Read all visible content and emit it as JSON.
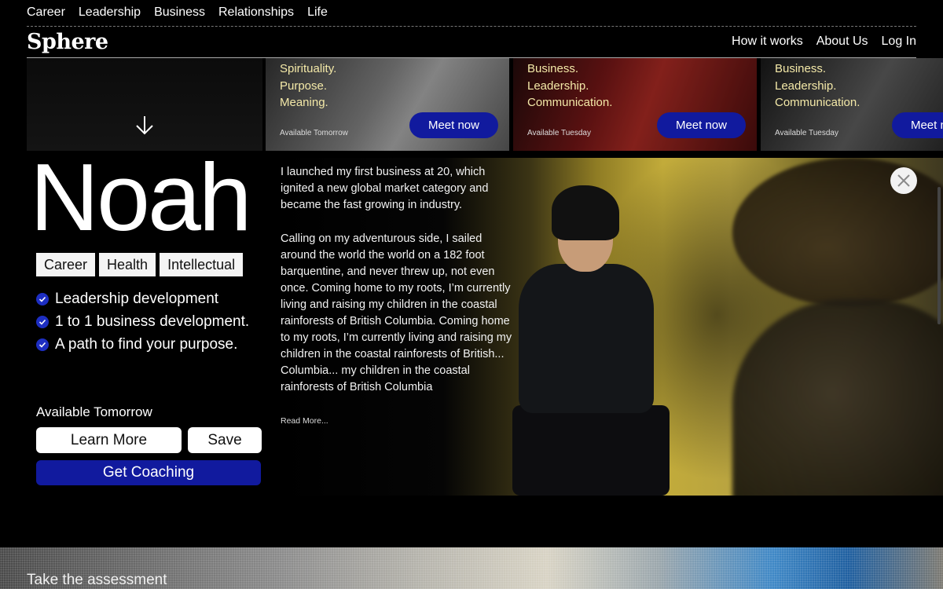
{
  "top_categories": [
    "Career",
    "Leadership",
    "Business",
    "Relationships",
    "Life"
  ],
  "logo": "Sphere",
  "main_nav": [
    "How it works",
    "About Us",
    "Log In"
  ],
  "carousel": [
    {
      "tags": [
        "Spirituality.",
        "Purpose.",
        "Meaning."
      ],
      "availability": "Available Tomorrow",
      "button": "Meet now"
    },
    {
      "tags": [
        "Business.",
        "Leadership.",
        "Communication."
      ],
      "availability": "Available Tuesday",
      "button": "Meet now"
    },
    {
      "tags": [
        "Business.",
        "Leadership.",
        "Communication."
      ],
      "availability": "Available Tuesday",
      "button": "Meet now"
    }
  ],
  "coach": {
    "name": "Noah",
    "categories": [
      "Career",
      "Health",
      "Intellectual"
    ],
    "highlights": [
      "Leadership development",
      "1 to 1 business development.",
      "A path to find your purpose."
    ],
    "availability": "Available Tomorrow",
    "learn_more": "Learn More",
    "save": "Save",
    "get_coaching": "Get Coaching",
    "bio": [
      "I launched my first business at 20, which ignited a new global market category and became the fast growing in industry.",
      "Calling on my adventurous side, I sailed around the world the world on a 182 foot barquentine, and never threw up, not even once. Coming home to my roots, I’m currently living and raising my children in the coastal rainforests of British Columbia. Coming home to my roots, I’m currently living and raising my children in the coastal rainforests of British... Columbia... my children in the coastal rainforests of British Columbia"
    ],
    "read_more": "Read More..."
  },
  "assessment_link": "Take the assessment",
  "colors": {
    "accent": "#111a9e",
    "tag_text": "#f4e9a8",
    "background": "#000000"
  }
}
